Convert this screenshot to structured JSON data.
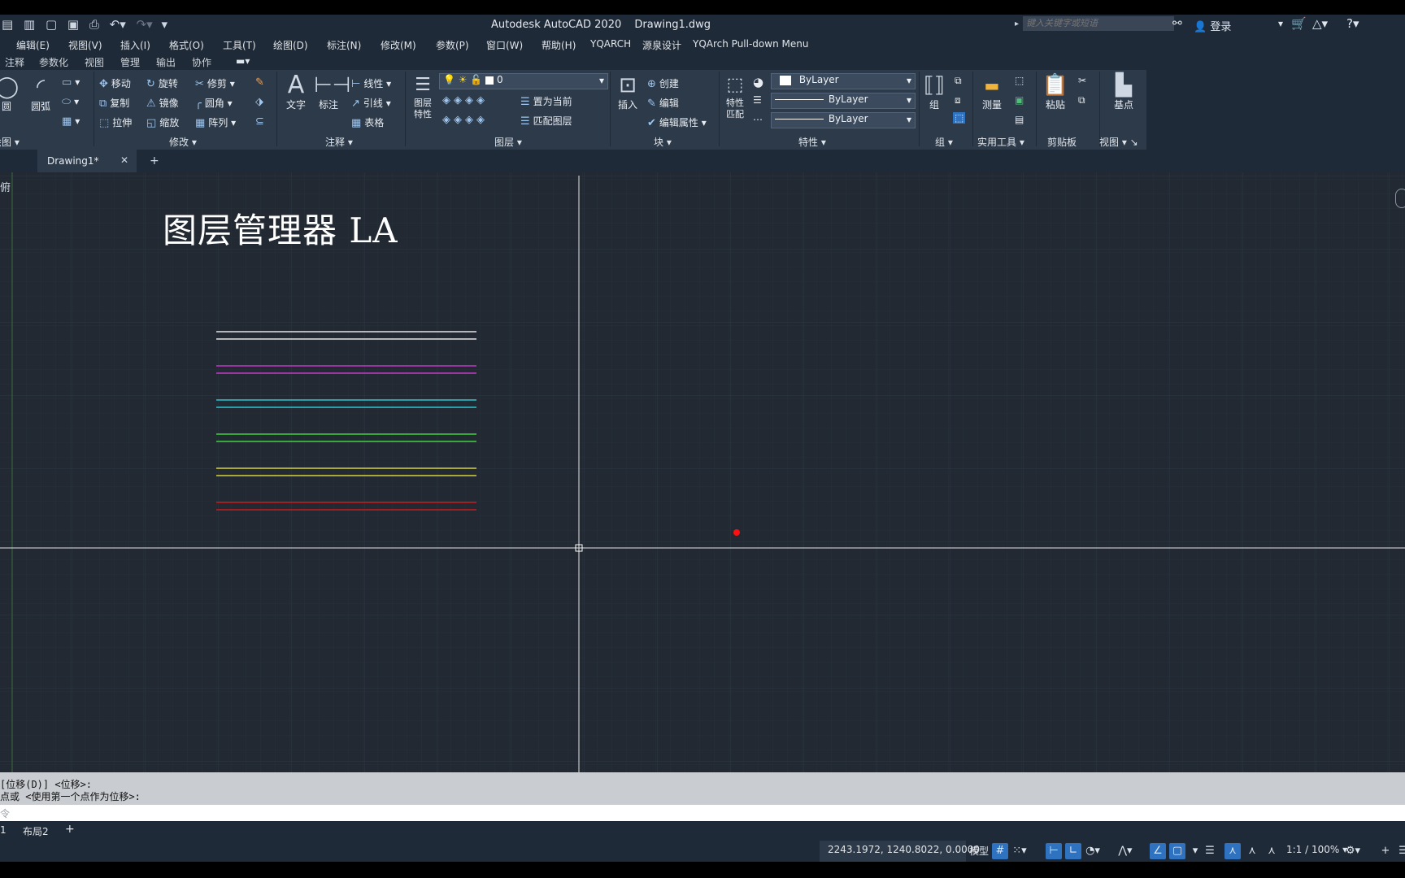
{
  "app": {
    "title": "Autodesk AutoCAD 2020",
    "file": "Drawing1.dwg",
    "search_placeholder": "键入关键字或短语",
    "login": "登录"
  },
  "menubar": [
    "编辑(E)",
    "视图(V)",
    "插入(I)",
    "格式(O)",
    "工具(T)",
    "绘图(D)",
    "标注(N)",
    "修改(M)",
    "参数(P)",
    "窗口(W)",
    "帮助(H)",
    "YQARCH",
    "源泉设计",
    "YQArch Pull-down Menu"
  ],
  "ribbon_tabs": [
    "注释",
    "参数化",
    "视图",
    "管理",
    "输出",
    "协作"
  ],
  "ribbon": {
    "draw": {
      "circle": "圆",
      "arc": "圆弧",
      "panel": "绘图"
    },
    "modify": {
      "move": "移动",
      "rotate": "旋转",
      "trim": "修剪",
      "copy": "复制",
      "mirror": "镜像",
      "fillet": "圆角",
      "stretch": "拉伸",
      "scale": "缩放",
      "array": "阵列",
      "panel": "修改"
    },
    "annotation": {
      "text": "文字",
      "dim": "标注",
      "linear": "线性",
      "leader": "引线",
      "table": "表格",
      "panel": "注释"
    },
    "layers": {
      "props": "图层特性",
      "current_layer": "0",
      "set_current": "置为当前",
      "match_layer": "匹配图层",
      "panel": "图层"
    },
    "block": {
      "insert": "插入",
      "create": "创建",
      "edit": "编辑",
      "edit_attr": "编辑属性",
      "panel": "块"
    },
    "properties": {
      "match": "特性匹配",
      "color": "ByLayer",
      "linetype": "ByLayer",
      "lineweight": "ByLayer",
      "panel": "特性"
    },
    "groups": {
      "group": "组",
      "panel": "组"
    },
    "utilities": {
      "measure": "测量",
      "panel": "实用工具"
    },
    "clipboard": {
      "paste": "粘贴",
      "panel": "剪贴板"
    },
    "view": {
      "base": "基点",
      "panel": "视图"
    }
  },
  "doc_tab": "Drawing1*",
  "canvas": {
    "title_text": "图层管理器 LA",
    "viewport_label": "俯",
    "line_colors": [
      "#e4e4e4",
      "#c23ac8",
      "#2fc6cf",
      "#3fd240",
      "#d8d43a",
      "#c81d1d"
    ]
  },
  "command": {
    "line1": "[位移(D)] <位移>:",
    "line2": "点或 <使用第一个点作为位移>:",
    "placeholder": "令"
  },
  "layouts": {
    "layout1": "1",
    "layout2": "布局2"
  },
  "status": {
    "coords": "2243.1972, 1240.8022, 0.0000",
    "model": "模型",
    "scale": "1:1 / 100%"
  }
}
